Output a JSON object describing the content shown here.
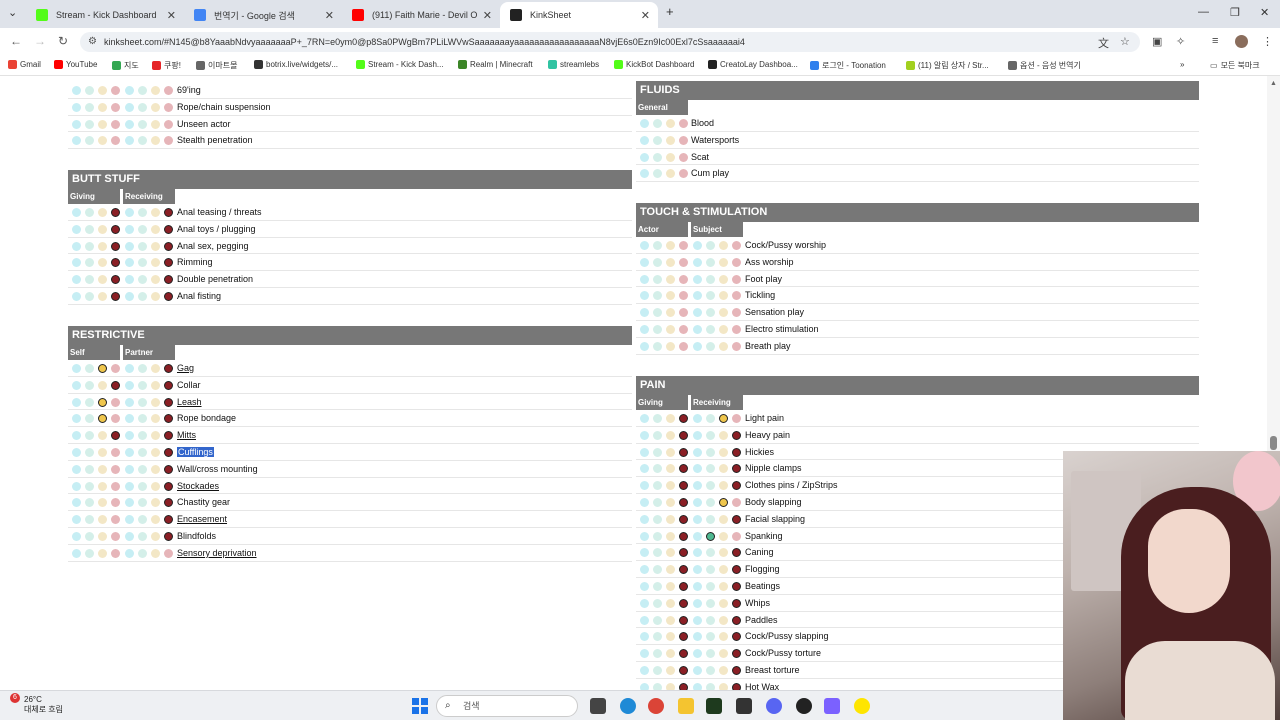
{
  "browser": {
    "tabs": [
      {
        "title": "Stream - Kick Dashboard",
        "color": "#53fc18",
        "active": false
      },
      {
        "title": "번역기 - Google 검색",
        "color": "#4285f4",
        "active": false
      },
      {
        "title": "(911) Faith Marie - Devil O",
        "color": "#ff0000",
        "active": false
      },
      {
        "title": "KinkSheet",
        "color": "#222222",
        "active": true
      }
    ],
    "url": "kinksheet.com/#N145@b8YaaabNdvyaaaaaaaP+_7RN=e0ym0@p8Sa0PWgBm7PLiLWVwSaaaaaaayaaaaaaaaaaaaaaaaaN8vjE6s0Ezn9Ic00Exl7cSsaaaaaai4",
    "bookmarks": [
      {
        "label": "Gmail",
        "color": "#ea4335"
      },
      {
        "label": "YouTube",
        "color": "#ff0000"
      },
      {
        "label": "지도",
        "color": "#34a853"
      },
      {
        "label": "쿠팡!",
        "color": "#e52528"
      },
      {
        "label": "이마트몰",
        "color": "#666666"
      },
      {
        "label": "botrix.live/widgets/...",
        "color": "#333333"
      },
      {
        "label": "Stream - Kick Dash...",
        "color": "#53fc18"
      },
      {
        "label": "Realm | Minecraft",
        "color": "#3c8527"
      },
      {
        "label": "streamlebs",
        "color": "#31c3a2"
      },
      {
        "label": "KickBot Dashboard",
        "color": "#53fc18"
      },
      {
        "label": "CreatoLay Dashboa...",
        "color": "#222222"
      },
      {
        "label": "로그인 - Toonation",
        "color": "#2f80ed"
      },
      {
        "label": "(11) 알림 상자 / Str...",
        "color": "#a2d01f"
      },
      {
        "label": "옵션 - 음성 번역기",
        "color": "#666666"
      }
    ],
    "bookmarks_folder": "모든 북마크"
  },
  "sections": {
    "topleft": {
      "items": [
        {
          "label": "69'ing",
          "a": -1,
          "b": -1
        },
        {
          "label": "Rope/chain suspension",
          "a": -1,
          "b": -1
        },
        {
          "label": "Unseen actor",
          "a": -1,
          "b": -1
        },
        {
          "label": "Stealth penetration",
          "a": -1,
          "b": -1
        }
      ]
    },
    "butt": {
      "title": "BUTT STUFF",
      "col1": "Giving",
      "col2": "Receiving",
      "items": [
        {
          "label": "Anal teasing / threats",
          "a": 3,
          "b": 3
        },
        {
          "label": "Anal toys / plugging",
          "a": 3,
          "b": 3
        },
        {
          "label": "Anal sex, pegging",
          "a": 3,
          "b": 3
        },
        {
          "label": "Rimming",
          "a": 3,
          "b": 3
        },
        {
          "label": "Double penetration",
          "a": 3,
          "b": 3
        },
        {
          "label": "Anal fisting",
          "a": 3,
          "b": 3
        }
      ]
    },
    "restrictive": {
      "title": "RESTRICTIVE",
      "col1": "Self",
      "col2": "Partner",
      "items": [
        {
          "label": "Gag",
          "a": 2,
          "b": 3,
          "ul": true
        },
        {
          "label": "Collar",
          "a": 3,
          "b": 3
        },
        {
          "label": "Leash",
          "a": 2,
          "b": 3,
          "ul": true
        },
        {
          "label": "Rope bondage",
          "a": 2,
          "b": 3
        },
        {
          "label": "Mitts",
          "a": 3,
          "b": 3,
          "ul": true
        },
        {
          "label": "Cufflings",
          "a": -1,
          "b": 3,
          "sel": true
        },
        {
          "label": "Wall/cross mounting",
          "a": -1,
          "b": 3
        },
        {
          "label": "Stockades",
          "a": -1,
          "b": 3,
          "ul": true
        },
        {
          "label": "Chastity gear",
          "a": -1,
          "b": 3
        },
        {
          "label": "Encasement",
          "a": -1,
          "b": 3,
          "ul": true
        },
        {
          "label": "Blindfolds",
          "a": -1,
          "b": 3
        },
        {
          "label": "Sensory deprivation",
          "a": -1,
          "b": -1,
          "ul": true
        }
      ]
    },
    "fluids": {
      "title": "FLUIDS",
      "col1": "General",
      "items": [
        {
          "label": "Blood",
          "a": -1
        },
        {
          "label": "Watersports",
          "a": -1
        },
        {
          "label": "Scat",
          "a": -1
        },
        {
          "label": "Cum play",
          "a": -1
        }
      ]
    },
    "touch": {
      "title": "TOUCH & STIMULATION",
      "col1": "Actor",
      "col2": "Subject",
      "items": [
        {
          "label": "Cock/Pussy worship",
          "a": -1,
          "b": -1
        },
        {
          "label": "Ass worship",
          "a": -1,
          "b": -1
        },
        {
          "label": "Foot play",
          "a": -1,
          "b": -1
        },
        {
          "label": "Tickling",
          "a": -1,
          "b": -1
        },
        {
          "label": "Sensation play",
          "a": -1,
          "b": -1
        },
        {
          "label": "Electro stimulation",
          "a": -1,
          "b": -1
        },
        {
          "label": "Breath play",
          "a": -1,
          "b": -1
        }
      ]
    },
    "pain": {
      "title": "PAIN",
      "col1": "Giving",
      "col2": "Receiving",
      "items": [
        {
          "label": "Light pain",
          "a": 3,
          "b": 2
        },
        {
          "label": "Heavy pain",
          "a": 3,
          "b": 3
        },
        {
          "label": "Hickies",
          "a": 3,
          "b": 3
        },
        {
          "label": "Nipple clamps",
          "a": 3,
          "b": 3
        },
        {
          "label": "Clothes pins / ZipStrips",
          "a": 3,
          "b": 3
        },
        {
          "label": "Body slapping",
          "a": 3,
          "b": 2
        },
        {
          "label": "Facial slapping",
          "a": 3,
          "b": 3
        },
        {
          "label": "Spanking",
          "a": 3,
          "b": 1
        },
        {
          "label": "Caning",
          "a": 3,
          "b": 3
        },
        {
          "label": "Flogging",
          "a": 3,
          "b": 3
        },
        {
          "label": "Beatings",
          "a": 3,
          "b": 3
        },
        {
          "label": "Whips",
          "a": 3,
          "b": 3
        },
        {
          "label": "Paddles",
          "a": 3,
          "b": 3
        },
        {
          "label": "Cock/Pussy slapping",
          "a": 3,
          "b": 3
        },
        {
          "label": "Cock/Pussy torture",
          "a": 3,
          "b": 3
        },
        {
          "label": "Breast torture",
          "a": 3,
          "b": 3
        },
        {
          "label": "Hot Wax",
          "a": 3,
          "b": 3
        }
      ]
    }
  },
  "taskbar": {
    "temperature": "26°C",
    "weather": "대체로 흐림",
    "badge": "6",
    "search_placeholder": "검색"
  }
}
